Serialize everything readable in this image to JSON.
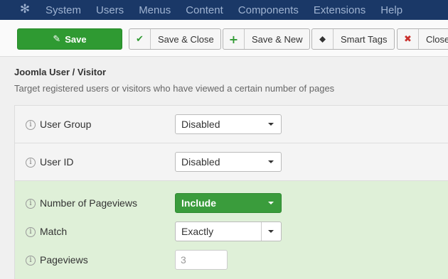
{
  "menu": {
    "logo_icon": "joomla-logo-icon",
    "items": [
      "System",
      "Users",
      "Menus",
      "Content",
      "Components",
      "Extensions",
      "Help"
    ]
  },
  "toolbar": {
    "save_label": "Save",
    "save_close_label": "Save & Close",
    "save_new_label": "Save & New",
    "smart_tags_label": "Smart Tags",
    "close_label": "Close"
  },
  "page": {
    "title": "Joomla User / Visitor",
    "description": "Target registered users or visitors who have viewed a certain number of pages"
  },
  "form": {
    "user_group": {
      "label": "User Group",
      "value": "Disabled"
    },
    "user_id": {
      "label": "User ID",
      "value": "Disabled"
    },
    "pageviews_number": {
      "label": "Number of Pageviews",
      "value": "Include"
    },
    "match": {
      "label": "Match",
      "value": "Exactly"
    },
    "pageviews": {
      "label": "Pageviews",
      "value": "3"
    }
  },
  "colors": {
    "topbar": "#1a3867",
    "save_button": "#2f9a32",
    "include_select": "#3a9c3c",
    "active_panel": "#dff0d8"
  }
}
